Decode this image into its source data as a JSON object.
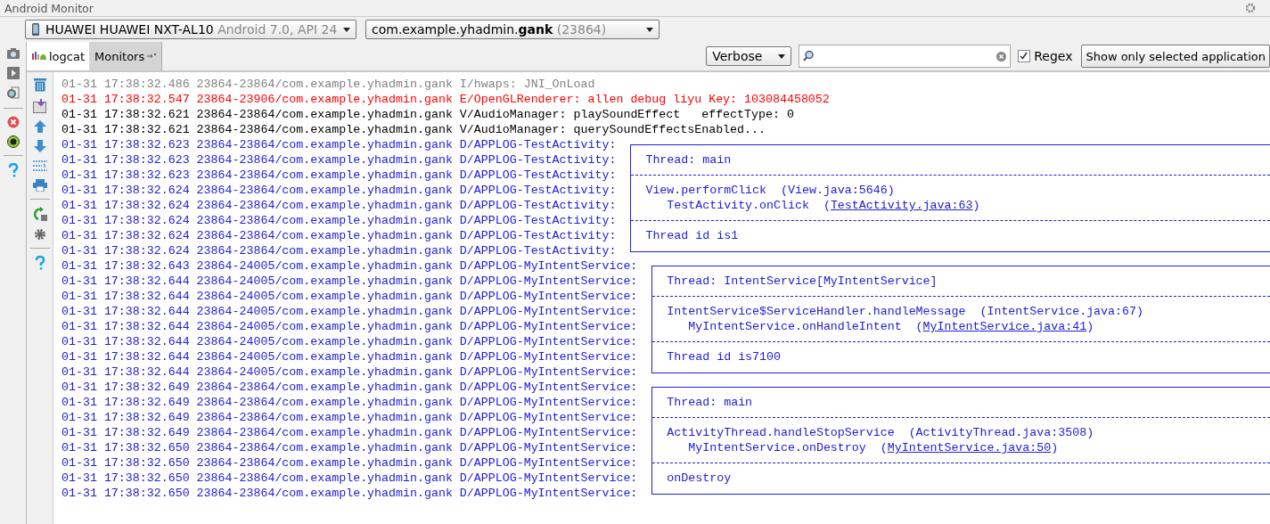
{
  "window": {
    "title": "Android Monitor"
  },
  "device_select": {
    "name": "HUAWEI HUAWEI NXT-AL10",
    "detail": "Android 7.0, API 24"
  },
  "process_select": {
    "prefix": "com.example.yhadmin.",
    "bold": "gank",
    "detail": "(23864)"
  },
  "tabs": [
    {
      "label": "logcat",
      "selected": true
    },
    {
      "label": "Monitors",
      "selected": false
    }
  ],
  "filter": {
    "level_select": "Verbose",
    "regex": {
      "label": "Regex",
      "checked": true
    },
    "scope_select": "Show only selected application"
  },
  "log": [
    {
      "head": "01-31 17:38:32.486 23864-23864/com.example.yhadmin.gank I/hwaps:",
      "color": "#808080",
      "kind": "plain",
      "message": "JNI_OnLoad"
    },
    {
      "head": "01-31 17:38:32.547 23864-23906/com.example.yhadmin.gank E/OpenGLRenderer:",
      "color": "#ff0000",
      "kind": "plain",
      "message": "allen debug liyu Key: 103084458052"
    },
    {
      "head": "01-31 17:38:32.621 23864-23864/com.example.yhadmin.gank V/AudioManager:",
      "color": "#000000",
      "kind": "plain",
      "message": "playSoundEffect   effectType: 0"
    },
    {
      "head": "01-31 17:38:32.621 23864-23864/com.example.yhadmin.gank V/AudioManager:",
      "color": "#000000",
      "kind": "plain",
      "message": "querySoundEffectsEnabled..."
    },
    {
      "head": "01-31 17:38:32.623 23864-23864/com.example.yhadmin.gank D/APPLOG-TestActivity:",
      "color": "#2020d8",
      "kind": "top"
    },
    {
      "head": "01-31 17:38:32.623 23864-23864/com.example.yhadmin.gank D/APPLOG-TestActivity:",
      "color": "#2020d8",
      "kind": "line",
      "message": "Thread: main"
    },
    {
      "head": "01-31 17:38:32.623 23864-23864/com.example.yhadmin.gank D/APPLOG-TestActivity:",
      "color": "#2020d8",
      "kind": "divider"
    },
    {
      "head": "01-31 17:38:32.624 23864-23864/com.example.yhadmin.gank D/APPLOG-TestActivity:",
      "color": "#2020d8",
      "kind": "line",
      "message": "View.performClick  (View.java:5646)"
    },
    {
      "head": "01-31 17:38:32.624 23864-23864/com.example.yhadmin.gank D/APPLOG-TestActivity:",
      "color": "#2020d8",
      "kind": "line",
      "message": "   TestActivity.onClick  (",
      "link": "TestActivity.java:63",
      "after": ")"
    },
    {
      "head": "01-31 17:38:32.624 23864-23864/com.example.yhadmin.gank D/APPLOG-TestActivity:",
      "color": "#2020d8",
      "kind": "divider"
    },
    {
      "head": "01-31 17:38:32.624 23864-23864/com.example.yhadmin.gank D/APPLOG-TestActivity:",
      "color": "#2020d8",
      "kind": "line",
      "message": "Thread id is1"
    },
    {
      "head": "01-31 17:38:32.624 23864-23864/com.example.yhadmin.gank D/APPLOG-TestActivity:",
      "color": "#2020d8",
      "kind": "bottom"
    },
    {
      "head": "01-31 17:38:32.643 23864-24005/com.example.yhadmin.gank D/APPLOG-MyIntentService:",
      "color": "#2020d8",
      "kind": "top"
    },
    {
      "head": "01-31 17:38:32.644 23864-24005/com.example.yhadmin.gank D/APPLOG-MyIntentService:",
      "color": "#2020d8",
      "kind": "line",
      "message": "Thread: IntentService[MyIntentService]"
    },
    {
      "head": "01-31 17:38:32.644 23864-24005/com.example.yhadmin.gank D/APPLOG-MyIntentService:",
      "color": "#2020d8",
      "kind": "divider"
    },
    {
      "head": "01-31 17:38:32.644 23864-24005/com.example.yhadmin.gank D/APPLOG-MyIntentService:",
      "color": "#2020d8",
      "kind": "line",
      "message": "IntentService$ServiceHandler.handleMessage  (IntentService.java:67)"
    },
    {
      "head": "01-31 17:38:32.644 23864-24005/com.example.yhadmin.gank D/APPLOG-MyIntentService:",
      "color": "#2020d8",
      "kind": "line",
      "message": "   MyIntentService.onHandleIntent  (",
      "link": "MyIntentService.java:41",
      "after": ")"
    },
    {
      "head": "01-31 17:38:32.644 23864-24005/com.example.yhadmin.gank D/APPLOG-MyIntentService:",
      "color": "#2020d8",
      "kind": "divider"
    },
    {
      "head": "01-31 17:38:32.644 23864-24005/com.example.yhadmin.gank D/APPLOG-MyIntentService:",
      "color": "#2020d8",
      "kind": "line",
      "message": "Thread id is7100"
    },
    {
      "head": "01-31 17:38:32.644 23864-24005/com.example.yhadmin.gank D/APPLOG-MyIntentService:",
      "color": "#2020d8",
      "kind": "bottom"
    },
    {
      "head": "01-31 17:38:32.649 23864-23864/com.example.yhadmin.gank D/APPLOG-MyIntentService:",
      "color": "#2020d8",
      "kind": "top"
    },
    {
      "head": "01-31 17:38:32.649 23864-23864/com.example.yhadmin.gank D/APPLOG-MyIntentService:",
      "color": "#2020d8",
      "kind": "line",
      "message": "Thread: main"
    },
    {
      "head": "01-31 17:38:32.649 23864-23864/com.example.yhadmin.gank D/APPLOG-MyIntentService:",
      "color": "#2020d8",
      "kind": "divider"
    },
    {
      "head": "01-31 17:38:32.649 23864-23864/com.example.yhadmin.gank D/APPLOG-MyIntentService:",
      "color": "#2020d8",
      "kind": "line",
      "message": "ActivityThread.handleStopService  (ActivityThread.java:3508)"
    },
    {
      "head": "01-31 17:38:32.650 23864-23864/com.example.yhadmin.gank D/APPLOG-MyIntentService:",
      "color": "#2020d8",
      "kind": "line",
      "message": "   MyIntentService.onDestroy  (",
      "link": "MyIntentService.java:50",
      "after": ")"
    },
    {
      "head": "01-31 17:38:32.650 23864-23864/com.example.yhadmin.gank D/APPLOG-MyIntentService:",
      "color": "#2020d8",
      "kind": "divider"
    },
    {
      "head": "01-31 17:38:32.650 23864-23864/com.example.yhadmin.gank D/APPLOG-MyIntentService:",
      "color": "#2020d8",
      "kind": "line",
      "message": "onDestroy"
    },
    {
      "head": "01-31 17:38:32.650 23864-23864/com.example.yhadmin.gank D/APPLOG-MyIntentService:",
      "color": "#2020d8",
      "kind": "bottom"
    }
  ]
}
